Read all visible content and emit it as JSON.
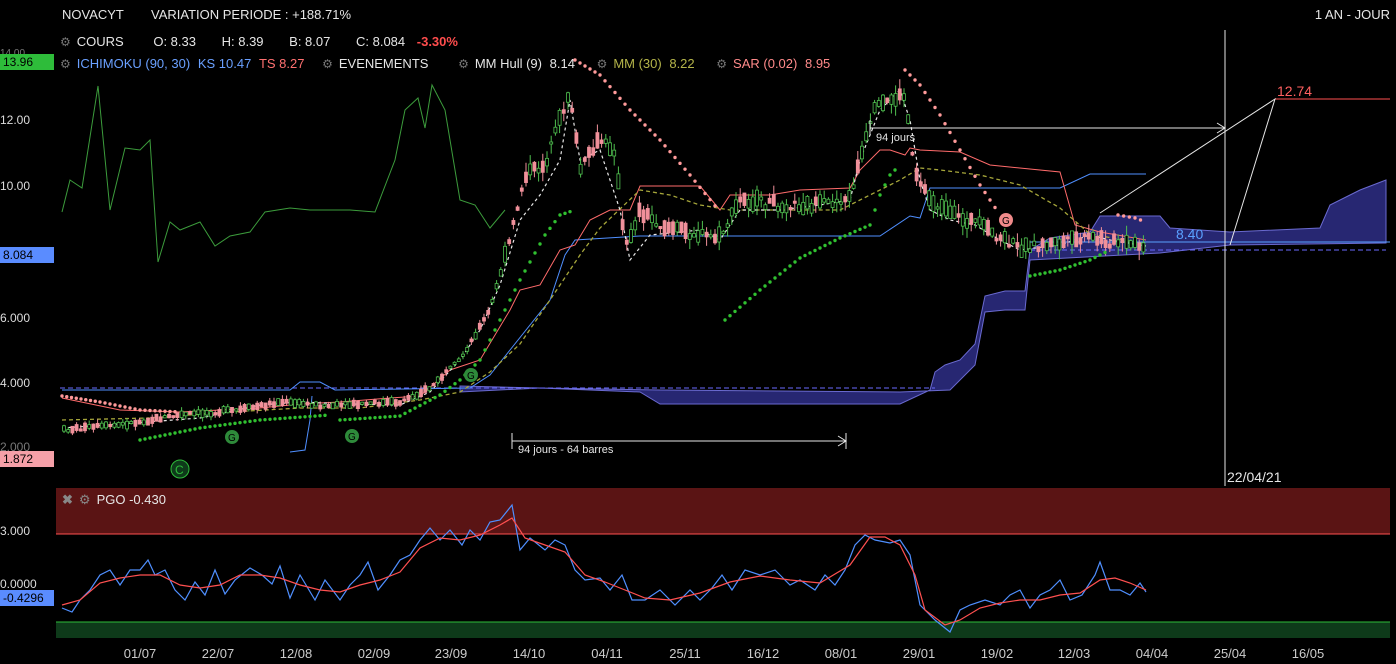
{
  "header": {
    "symbol": "NOVACYT",
    "variation": "VARIATION PERIODE : +188.71%",
    "period": "1 AN - JOUR"
  },
  "legend_row1": {
    "cours": "COURS",
    "open": "O: 8.33",
    "high": "H: 8.39",
    "low": "B: 8.07",
    "close": "C: 8.084",
    "change": "-3.30%"
  },
  "legend_row2": {
    "ichimoku": "ICHIMOKU (90, 30)",
    "ks": "KS 10.47",
    "ts": "TS 8.27",
    "events": "EVENEMENTS",
    "hull": "MM Hull (9)",
    "hull_val": "8.14",
    "mm": "MM (30)",
    "mm_val": "8.22",
    "sar": "SAR (0.02)",
    "sar_val": "8.95"
  },
  "price_axis": {
    "ticks": [
      "12.00",
      "10.00",
      "8.084",
      "6.000",
      "4.000",
      "2.000"
    ],
    "top_tag": "13.96",
    "current_tag": "8.084",
    "bottom_tag": "1.872",
    "top_partial": "14.00"
  },
  "annotations": {
    "days_top": "94 jours",
    "days_bottom": "94 jours - 64 barres",
    "target_high": "12.74",
    "target_low": "8.40",
    "vline_date": "22/04/21",
    "signal_G": "G",
    "signal_C": "C"
  },
  "oscillator": {
    "title": "PGO -0.430",
    "ticks": [
      "3.000",
      "0.0000"
    ],
    "current_tag": "-0.4296"
  },
  "x_axis": [
    "01/07",
    "22/07",
    "12/08",
    "02/09",
    "23/09",
    "14/10",
    "04/11",
    "25/11",
    "16/12",
    "08/01",
    "29/01",
    "19/02",
    "12/03",
    "04/04",
    "25/04",
    "16/05"
  ],
  "colors": {
    "up": "#4fc04f",
    "down": "#f0909a",
    "tenkan": "#ff6b6b",
    "kijun": "#4f8fff",
    "chikou": "#3c9c3c",
    "mm": "#9c9c3c",
    "sar_up": "#30c030",
    "sar_down": "#ff8080",
    "cloud": "#2e2e86",
    "pgo": "#4f8fff",
    "pgo_signal": "#ff5050",
    "tag_blue": "#5a8cff",
    "tag_green": "#2ebc3a",
    "tag_pink": "#f5a0a8",
    "band_top": "#5a1414",
    "band_bottom": "#0e3a1a"
  },
  "chart_data": {
    "type": "line",
    "title": "NOVACYT",
    "x": [
      "01/07",
      "22/07",
      "12/08",
      "02/09",
      "23/09",
      "14/10",
      "04/11",
      "25/11",
      "16/12",
      "08/01",
      "29/01",
      "19/02",
      "12/03",
      "04/04"
    ],
    "series": [
      {
        "name": "COURS",
        "values": [
          3.0,
          3.2,
          3.4,
          3.2,
          4.0,
          12.5,
          8.4,
          8.5,
          9.4,
          9.4,
          12.6,
          8.6,
          8.2,
          8.084
        ]
      },
      {
        "name": "MM (30)",
        "values": [
          2.9,
          3.1,
          3.3,
          3.3,
          3.6,
          6.5,
          9.5,
          8.4,
          9.2,
          9.3,
          10.5,
          9.6,
          8.5,
          8.22
        ]
      },
      {
        "name": "SAR (0.02)",
        "values": [
          3.8,
          2.7,
          3.0,
          3.0,
          3.5,
          12.0,
          10.0,
          9.5,
          8.2,
          8.7,
          12.3,
          9.2,
          7.8,
          8.95
        ]
      }
    ],
    "ylim": [
      1.8,
      14.0
    ],
    "oscillator": {
      "name": "PGO",
      "ylim": [
        -1.5,
        4.5
      ],
      "values": [
        -0.6,
        1.3,
        0.7,
        0.0,
        0.4,
        3.6,
        0.3,
        0.1,
        0.4,
        0.1,
        1.8,
        -1.4,
        0.4,
        -0.43
      ]
    }
  }
}
